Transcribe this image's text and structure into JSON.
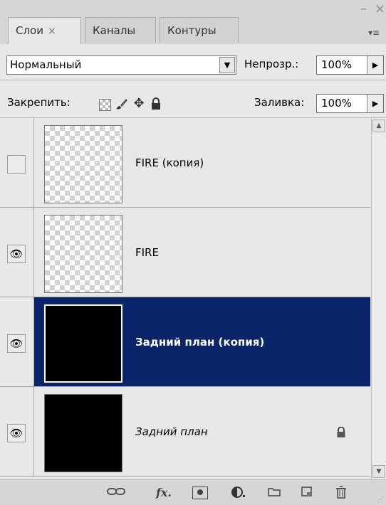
{
  "tabs": [
    {
      "label": "Слои",
      "close": "×"
    },
    {
      "label": "Каналы"
    },
    {
      "label": "Контуры"
    }
  ],
  "window": {
    "minimize": "–",
    "close": "×",
    "menu": "▾≡"
  },
  "blend": {
    "mode": "Нормальный",
    "arrow": "▼"
  },
  "opacity": {
    "label": "Непрозр.:",
    "value": "100%",
    "arrow": "▶"
  },
  "lock": {
    "label": "Закрепить:",
    "icons": [
      "transparency-lock-icon",
      "brush-icon",
      "move-icon",
      "lock-icon"
    ]
  },
  "fill": {
    "label": "Заливка:",
    "value": "100%",
    "arrow": "▶"
  },
  "layers": [
    {
      "name": "FIRE (копия)",
      "visible": false,
      "thumb": "transparent",
      "selected": false,
      "locked": false
    },
    {
      "name": "FIRE",
      "visible": true,
      "thumb": "transparent",
      "selected": false,
      "locked": false
    },
    {
      "name": "Задний план (копия)",
      "visible": true,
      "thumb": "black",
      "selected": true,
      "locked": false
    },
    {
      "name": "Задний план",
      "visible": true,
      "thumb": "black",
      "selected": false,
      "locked": true
    }
  ],
  "icons": {
    "eye": "👁",
    "lock": "🔒"
  },
  "bottom_bar": [
    "link-layers-icon",
    "fx-icon",
    "mask-icon",
    "adjustment-icon",
    "folder-icon",
    "new-layer-icon",
    "trash-icon"
  ],
  "colors": {
    "selection": "#0a246a",
    "panel": "#e8e8e8"
  }
}
